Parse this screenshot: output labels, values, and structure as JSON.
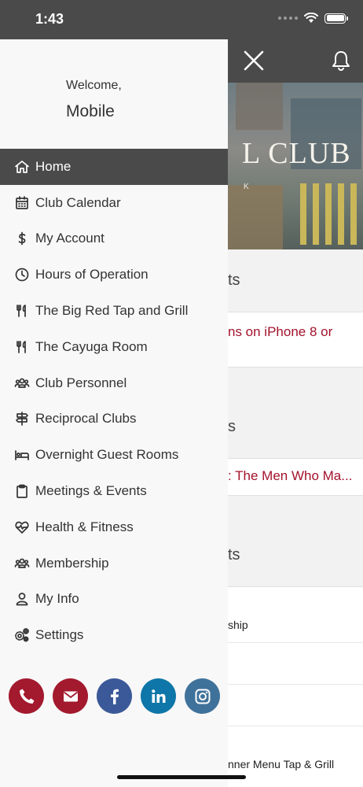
{
  "status_bar": {
    "time": "1:43"
  },
  "drawer": {
    "welcome": "Welcome,",
    "user_name": "Mobile",
    "menu": [
      {
        "label": "Home",
        "icon": "home-icon",
        "active": true
      },
      {
        "label": "Club Calendar",
        "icon": "calendar-icon"
      },
      {
        "label": "My Account",
        "icon": "dollar-icon"
      },
      {
        "label": "Hours of Operation",
        "icon": "clock-icon"
      },
      {
        "label": "The Big Red Tap and Grill",
        "icon": "utensils-icon"
      },
      {
        "label": "The Cayuga Room",
        "icon": "utensils-icon"
      },
      {
        "label": "Club Personnel",
        "icon": "people-icon"
      },
      {
        "label": "Reciprocal Clubs",
        "icon": "signpost-icon"
      },
      {
        "label": "Overnight Guest Rooms",
        "icon": "bed-icon"
      },
      {
        "label": "Meetings & Events",
        "icon": "clipboard-icon"
      },
      {
        "label": "Health & Fitness",
        "icon": "heartbeat-icon"
      },
      {
        "label": "Membership",
        "icon": "people-icon"
      },
      {
        "label": "My Info",
        "icon": "user-icon"
      },
      {
        "label": "Settings",
        "icon": "gears-icon"
      }
    ],
    "socials": [
      {
        "name": "phone",
        "color": "#a3192e"
      },
      {
        "name": "email",
        "color": "#a3192e"
      },
      {
        "name": "facebook",
        "color": "#3b5998"
      },
      {
        "name": "linkedin",
        "color": "#0e76a8"
      },
      {
        "name": "instagram",
        "color": "#3f729b"
      }
    ]
  },
  "background": {
    "banner_title": "L CLUB",
    "banner_small": "K",
    "section_1": "ts",
    "link_1": "ns on iPhone 8 or",
    "section_2": "s",
    "link_2": ": The Men Who Ma...",
    "section_3": "ts",
    "item_1": "ship",
    "item_4": "nner Menu Tap & Grill"
  },
  "colors": {
    "header": "#4a4a4a",
    "accent_red": "#a3122b"
  }
}
